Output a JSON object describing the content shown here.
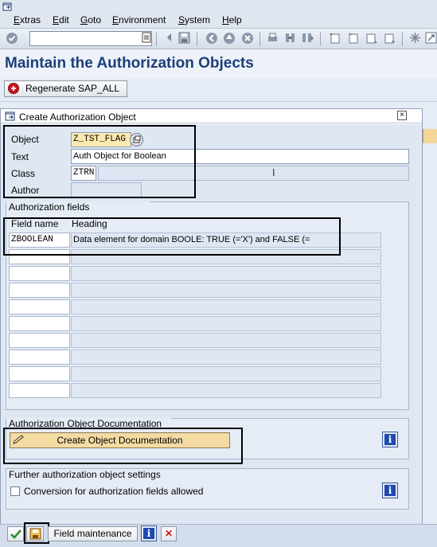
{
  "menu": {
    "items": [
      "Extras",
      "Edit",
      "Goto",
      "Environment",
      "System",
      "Help"
    ],
    "underline_index": [
      0,
      0,
      0,
      0,
      0,
      0
    ]
  },
  "toolbar": {
    "command_field_value": "",
    "icons": [
      "enter-icon",
      "dropdown-icon",
      "back-arrow-icon",
      "save-icon",
      "back-icon",
      "exit-icon",
      "cancel-icon",
      "print-icon",
      "find-icon",
      "find-next-icon",
      "first-page-icon",
      "previous-page-icon",
      "next-page-icon",
      "last-page-icon",
      "new-session-icon",
      "help-icon"
    ]
  },
  "page": {
    "title": "Maintain the Authorization Objects"
  },
  "app_toolbar": {
    "regenerate_label": "Regenerate SAP_ALL"
  },
  "dialog": {
    "title": "Create Authorization Object",
    "object_label": "Object",
    "object_value": "Z_TST_FLAG",
    "text_label": "Text",
    "text_value": "Auth Object for Boolean",
    "class_label": "Class",
    "class_value": "ZTRN",
    "class_desc": "",
    "author_label": "Author",
    "author_value": ""
  },
  "auth_fields": {
    "group_title": "Authorization fields",
    "col_field_name": "Field name",
    "col_heading": "Heading",
    "rows": [
      {
        "field": "ZBOOLEAN",
        "heading": "Data element for domain BOOLE: TRUE (='X') and FALSE (="
      },
      {
        "field": "",
        "heading": ""
      },
      {
        "field": "",
        "heading": ""
      },
      {
        "field": "",
        "heading": ""
      },
      {
        "field": "",
        "heading": ""
      },
      {
        "field": "",
        "heading": ""
      },
      {
        "field": "",
        "heading": ""
      },
      {
        "field": "",
        "heading": ""
      },
      {
        "field": "",
        "heading": ""
      },
      {
        "field": "",
        "heading": ""
      }
    ]
  },
  "documentation": {
    "group_title": "Authorization Object Documentation",
    "button_label": "Create Object Documentation",
    "info_label": "i"
  },
  "further": {
    "group_title": "Further authorization object settings",
    "checkbox_label": "Conversion for authorization fields allowed",
    "checked": false,
    "info_label": "i"
  },
  "footer": {
    "field_maintenance_label": "Field maintenance",
    "info_label": "i",
    "cancel_glyph": "✕",
    "accept_glyph": "✔"
  },
  "colors": {
    "title": "#1c3f7a",
    "yellow_field": "#fbeab0",
    "button_yellow": "#f4dba3",
    "info_blue": "#1e4ab0",
    "cancel_red": "#c8171c",
    "accept_green": "#2e8b2e"
  }
}
